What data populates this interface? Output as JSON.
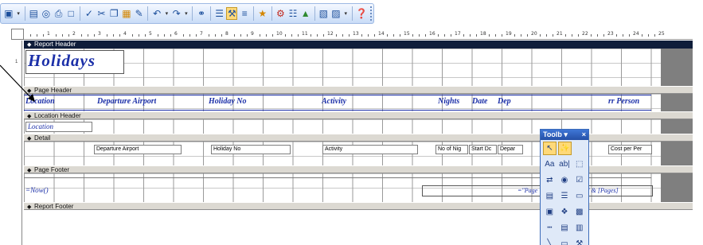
{
  "toolbar": {
    "buttons": [
      {
        "icon": "view-icon",
        "glyph": "▣"
      },
      {
        "icon": "save-icon",
        "glyph": "▤"
      },
      {
        "icon": "search-icon",
        "glyph": "◎"
      },
      {
        "icon": "print-icon",
        "glyph": "⎙"
      },
      {
        "icon": "print-preview-icon",
        "glyph": "□"
      },
      {
        "icon": "spelling-icon",
        "glyph": "✓"
      },
      {
        "icon": "cut-icon",
        "glyph": "✂"
      },
      {
        "icon": "copy-icon",
        "glyph": "❐"
      },
      {
        "icon": "paste-icon",
        "glyph": "▦"
      },
      {
        "icon": "format-painter-icon",
        "glyph": "✎"
      },
      {
        "icon": "undo-icon",
        "glyph": "↶"
      },
      {
        "icon": "redo-icon",
        "glyph": "↷"
      },
      {
        "icon": "hyperlink-icon",
        "glyph": "⚭"
      },
      {
        "icon": "field-list-icon",
        "glyph": "☰"
      },
      {
        "icon": "toolbox-icon",
        "glyph": "⚒"
      },
      {
        "icon": "sorting-grouping-icon",
        "glyph": "≡"
      },
      {
        "icon": "autoformat-icon",
        "glyph": "★"
      },
      {
        "icon": "code-icon",
        "glyph": "⚙"
      },
      {
        "icon": "properties-icon",
        "glyph": "☷"
      },
      {
        "icon": "build-icon",
        "glyph": "▲"
      },
      {
        "icon": "database-window-icon",
        "glyph": "▧"
      },
      {
        "icon": "new-object-icon",
        "glyph": "▨"
      },
      {
        "icon": "help-icon",
        "glyph": "❓"
      }
    ]
  },
  "sections": {
    "report_header": "Report Header",
    "page_header": "Page Header",
    "location_header": "Location Header",
    "detail": "Detail",
    "page_footer": "Page Footer",
    "report_footer": "Report Footer"
  },
  "report_title": "Holidays",
  "page_header_labels": {
    "location": "Location",
    "departure_airport": "Departure Airport",
    "holiday_no": "Holiday No",
    "activity": "Activity",
    "nights": "Nights",
    "date": "Date",
    "dep": "Dep",
    "per_person": "rr Person"
  },
  "location_header_field": "Location",
  "detail_fields": {
    "departure_airport": "Departure Airport",
    "holiday_no": "Holiday No",
    "activity": "Activity",
    "no_of_nights": "No of Nig",
    "start_date": "Start Dc",
    "departure": "Depar",
    "cost_per_person": "Cost per Per"
  },
  "page_footer": {
    "now": "=Now()",
    "pages": "=\"Page \" & [Page] & \" of \" & [Pages]"
  },
  "toolbox": {
    "title": "Toolb",
    "menu_glyph": "▾",
    "close_glyph": "×",
    "tools": [
      [
        "select-objects-icon",
        "↖"
      ],
      [
        "control-wizards-icon",
        "✨"
      ],
      [
        "label-icon",
        "Aa"
      ],
      [
        "text-box-icon",
        "ab|"
      ],
      [
        "option-group-icon",
        "⬚"
      ],
      [
        "toggle-button-icon",
        "⇄"
      ],
      [
        "option-button-icon",
        "◉"
      ],
      [
        "check-box-icon",
        "☑"
      ],
      [
        "combo-box-icon",
        "▤"
      ],
      [
        "list-box-icon",
        "☰"
      ],
      [
        "command-button-icon",
        "▭"
      ],
      [
        "image-icon",
        "▣"
      ],
      [
        "unbound-object-icon",
        "❖"
      ],
      [
        "bound-object-icon",
        "▩"
      ],
      [
        "page-break-icon",
        "┅"
      ],
      [
        "tab-control-icon",
        "▤"
      ],
      [
        "subform-icon",
        "▥"
      ],
      [
        "line-icon",
        "╲"
      ],
      [
        "rectangle-icon",
        "▭"
      ],
      [
        "more-controls-icon",
        "⚒"
      ]
    ]
  },
  "ruler_numbers": [
    "1",
    "2",
    "3",
    "4",
    "5",
    "6",
    "7",
    "8",
    "9",
    "10",
    "11",
    "12",
    "13",
    "14",
    "15",
    "16",
    "17",
    "18",
    "19",
    "20",
    "21",
    "22",
    "23",
    "24",
    "25"
  ],
  "vertical_ruler_number": "1"
}
